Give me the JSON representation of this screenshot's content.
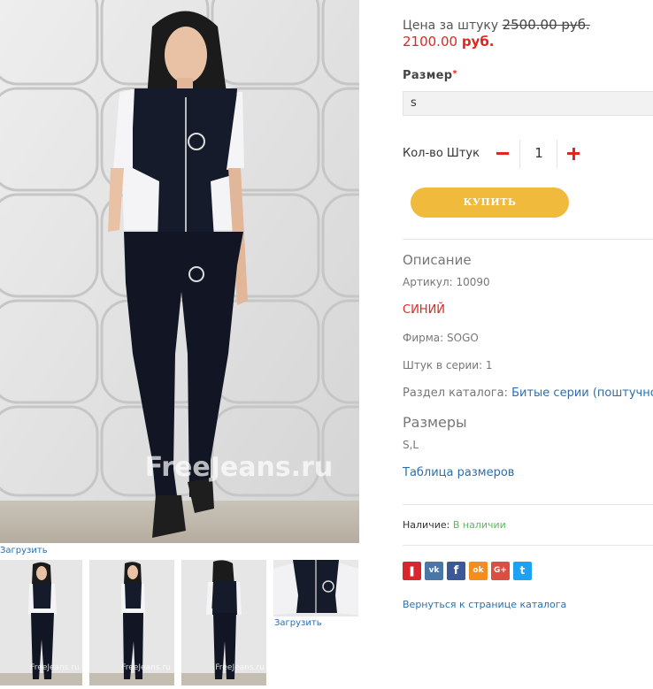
{
  "gallery": {
    "watermark": "FreeJeans.ru",
    "thumb_watermark": "FreeJeans.ru",
    "upload_label_main": "Загрузить",
    "upload_label_thumb": "Загрузить"
  },
  "product": {
    "price_label": "Цена за штуку",
    "old_price": "2500.00 руб.",
    "new_price_amount": "2100.00",
    "new_price_currency": "руб.",
    "size_label": "Размер",
    "size_required_mark": "*",
    "size_selected": "s",
    "qty_label": "Кол-во Штук",
    "qty_value": "1",
    "buy_label": "КУПИТЬ"
  },
  "description": {
    "title": "Описание",
    "article": "Артикул: 10090",
    "color": "СИНИЙ",
    "brand": "Фирма: SOGO",
    "pieces": "Штук в серии: 1",
    "catalog_prefix": "Раздел каталога:",
    "catalog_link": "Битые серии (поштучно"
  },
  "sizes": {
    "title": "Размеры",
    "values": "S,L",
    "table_link": "Таблица размеров"
  },
  "availability": {
    "label": "Наличие:",
    "status": "В наличии"
  },
  "share": {
    "buttons": [
      {
        "name": "bookmark-icon",
        "glyph": "❚",
        "color": "#d8262c"
      },
      {
        "name": "vk-icon",
        "glyph": "vk",
        "color": "#4a76a8"
      },
      {
        "name": "facebook-icon",
        "glyph": "f",
        "color": "#3b5998"
      },
      {
        "name": "odnoklassniki-icon",
        "glyph": "ok",
        "color": "#f38e1e"
      },
      {
        "name": "google-plus-icon",
        "glyph": "G+",
        "color": "#dc4e41"
      },
      {
        "name": "twitter-icon",
        "glyph": "t",
        "color": "#1da1f2"
      }
    ]
  },
  "nav": {
    "back_label": "Вернуться к странице каталога"
  },
  "colors": {
    "accent_red": "#e0261f",
    "buy_yellow": "#f0bb3c",
    "link_blue": "#2a6fb0",
    "available_green": "#5fb85f"
  }
}
